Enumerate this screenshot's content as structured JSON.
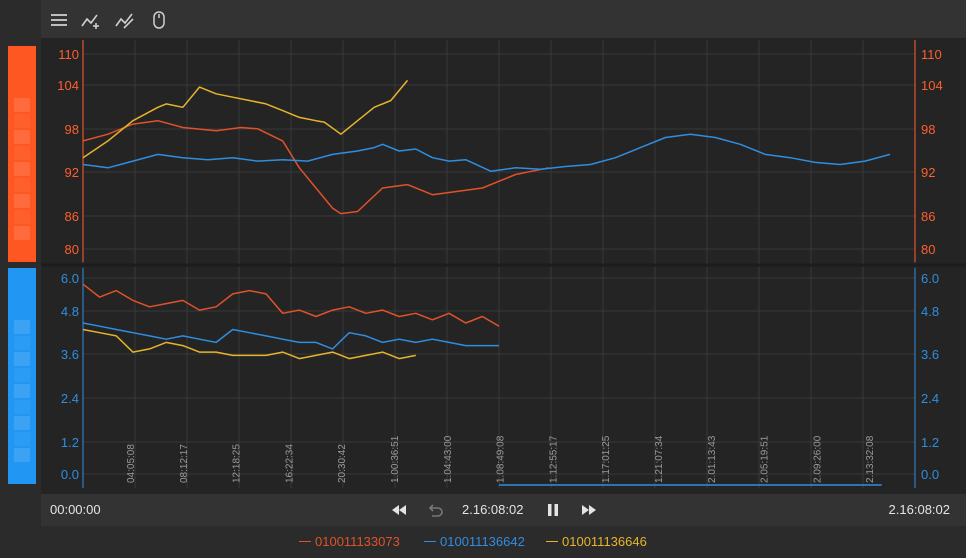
{
  "toolbar": {
    "icons": [
      "menu-icon",
      "add-series-icon",
      "edit-series-icon",
      "mouse-icon"
    ]
  },
  "colors": {
    "series_orange": "#e0522a",
    "series_blue": "#2f8ee0",
    "series_yellow": "#e6b52a",
    "axis_top": "#ff5f2e",
    "axis_bottom": "#2f8ee0",
    "swatch_top": "#ff5722",
    "swatch_bottom": "#2196f3"
  },
  "playback": {
    "start_time": "00:00:00",
    "current_time": "2.16:08:02",
    "end_time": "2.16:08:02"
  },
  "legend": [
    {
      "label": "010011133073",
      "color": "#e0522a"
    },
    {
      "label": "010011136642",
      "color": "#2f8ee0"
    },
    {
      "label": "010011136646",
      "color": "#e6b52a"
    }
  ],
  "chart_data": [
    {
      "type": "line",
      "panel": "top",
      "y_ticks": [
        "110",
        "104",
        "98",
        "92",
        "86",
        "80"
      ],
      "ylim": [
        79,
        112
      ],
      "series": [
        {
          "name": "010011133073",
          "color": "#e0522a",
          "x": [
            0,
            3,
            6,
            9,
            12,
            16,
            19,
            21,
            24,
            26,
            29,
            30,
            31,
            33,
            36,
            39,
            42,
            45,
            48,
            52,
            56
          ],
          "y": [
            97,
            98,
            99.5,
            100,
            99,
            98.5,
            99,
            98.8,
            97,
            93,
            88.5,
            87,
            86.2,
            86.5,
            90,
            90.5,
            89,
            89.5,
            90,
            92,
            93
          ]
        },
        {
          "name": "010011136642",
          "color": "#2f8ee0",
          "x": [
            0,
            3,
            6,
            9,
            12,
            15,
            18,
            21,
            24,
            27,
            30,
            33,
            35,
            36,
            38,
            40,
            42,
            44,
            46,
            49,
            52,
            55,
            58,
            61,
            64,
            67,
            70,
            73,
            76,
            79,
            82,
            85,
            88,
            91,
            94,
            97
          ],
          "y": [
            93.5,
            93,
            94,
            95,
            94.5,
            94.2,
            94.5,
            94,
            94.2,
            94,
            95,
            95.5,
            96,
            96.5,
            95.5,
            95.8,
            94.5,
            94,
            94.2,
            92.5,
            93,
            92.8,
            93.2,
            93.5,
            94.5,
            96,
            97.5,
            98,
            97.5,
            96.5,
            95,
            94.5,
            93.8,
            93.5,
            94,
            95
          ]
        },
        {
          "name": "010011136646",
          "color": "#e6b52a",
          "x": [
            0,
            3,
            6,
            9,
            10,
            12,
            14,
            16,
            18,
            20,
            22,
            24,
            26,
            28,
            29,
            31,
            33,
            35,
            37,
            39
          ],
          "y": [
            94.5,
            97,
            100,
            102,
            102.5,
            102,
            105,
            104,
            103.5,
            103,
            102.5,
            101.5,
            100.5,
            100,
            99.8,
            98,
            100,
            102,
            103,
            106
          ]
        }
      ]
    },
    {
      "type": "line",
      "panel": "bottom",
      "y_ticks": [
        "6.0",
        "4.8",
        "3.6",
        "2.4",
        "1.2",
        "0.0"
      ],
      "ylim": [
        -0.5,
        6.3
      ],
      "x_ticks": [
        "04:05:08",
        "08:12:17",
        "12:18:25",
        "16:22:34",
        "20:30:42",
        "1.00:36:51",
        "1.04:43:00",
        "1.08:49:08",
        "1.12:55:17",
        "1.17:01:25",
        "1.21:07:34",
        "2.01:13:43",
        "2.05:19:51",
        "2.09:26:00",
        "2.13:32:08"
      ],
      "series": [
        {
          "name": "010011133073",
          "color": "#e0522a",
          "x": [
            0,
            2,
            4,
            6,
            8,
            10,
            12,
            14,
            16,
            18,
            20,
            22,
            24,
            26,
            28,
            30,
            32,
            34,
            36,
            38,
            40,
            42,
            44,
            46,
            48,
            50
          ],
          "y": [
            5.8,
            5.4,
            5.6,
            5.3,
            5.1,
            5.2,
            5.3,
            5.0,
            5.1,
            5.5,
            5.6,
            5.5,
            4.9,
            5.0,
            4.8,
            5.0,
            5.1,
            4.9,
            5.0,
            4.8,
            4.9,
            4.7,
            4.9,
            4.6,
            4.8,
            4.5
          ]
        },
        {
          "name": "010011136642",
          "color": "#2f8ee0",
          "x": [
            0,
            2,
            4,
            6,
            8,
            10,
            12,
            14,
            16,
            18,
            20,
            22,
            24,
            26,
            28,
            30,
            32,
            34,
            36,
            38,
            40,
            42,
            44,
            46,
            48,
            50
          ],
          "y": [
            4.6,
            4.5,
            4.4,
            4.3,
            4.2,
            4.1,
            4.2,
            4.1,
            4.0,
            4.4,
            4.3,
            4.2,
            4.1,
            4.0,
            4.0,
            3.8,
            4.3,
            4.2,
            4.0,
            4.1,
            4.0,
            4.1,
            4.0,
            3.9,
            3.9,
            3.9
          ]
        },
        {
          "name": "010011136646",
          "color": "#e6b52a",
          "x": [
            0,
            2,
            4,
            6,
            8,
            10,
            12,
            14,
            16,
            18,
            20,
            22,
            24,
            26,
            28,
            30,
            32,
            34,
            36,
            38,
            40
          ],
          "y": [
            4.4,
            4.3,
            4.2,
            3.7,
            3.8,
            4.0,
            3.9,
            3.7,
            3.7,
            3.6,
            3.6,
            3.6,
            3.7,
            3.5,
            3.6,
            3.7,
            3.5,
            3.6,
            3.7,
            3.5,
            3.6
          ]
        }
      ]
    }
  ]
}
